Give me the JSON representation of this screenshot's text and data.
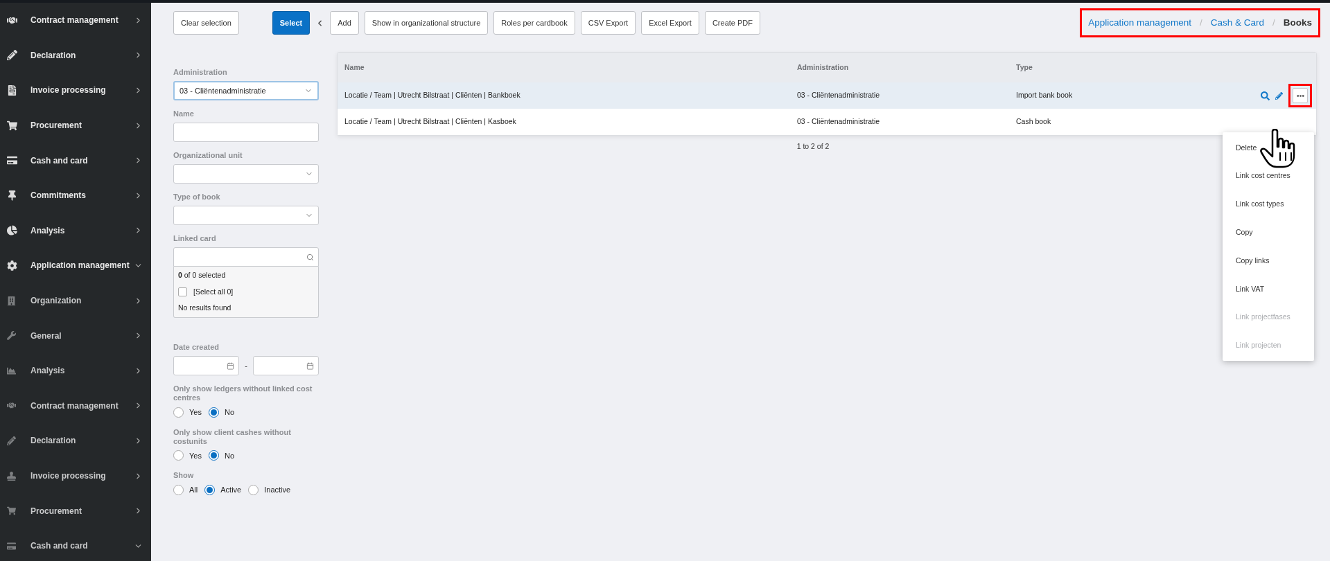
{
  "sidebar": {
    "items": [
      {
        "label": "Contract management",
        "expanded": false
      },
      {
        "label": "Declaration",
        "expanded": false
      },
      {
        "label": "Invoice processing",
        "expanded": false
      },
      {
        "label": "Procurement",
        "expanded": false
      },
      {
        "label": "Cash and card",
        "expanded": false
      },
      {
        "label": "Commitments",
        "expanded": false
      },
      {
        "label": "Analysis",
        "expanded": false
      },
      {
        "label": "Application management",
        "expanded": true,
        "children": [
          {
            "label": "Organization",
            "expanded": false
          },
          {
            "label": "General",
            "expanded": false
          },
          {
            "label": "Analysis",
            "expanded": false
          },
          {
            "label": "Contract management",
            "expanded": false
          },
          {
            "label": "Declaration",
            "expanded": false
          },
          {
            "label": "Invoice processing",
            "expanded": false
          },
          {
            "label": "Procurement",
            "expanded": false
          },
          {
            "label": "Cash and card",
            "expanded": true
          }
        ]
      }
    ]
  },
  "toolbar": {
    "buttons": [
      {
        "label": "Clear selection",
        "kind": "default"
      },
      {
        "label": "Select",
        "kind": "primary"
      },
      {
        "label": "Add",
        "kind": "default"
      },
      {
        "label": "Show in organizational structure",
        "kind": "default"
      },
      {
        "label": "Roles per cardbook",
        "kind": "default"
      },
      {
        "label": "CSV Export",
        "kind": "default"
      },
      {
        "label": "Excel Export",
        "kind": "default"
      },
      {
        "label": "Create PDF",
        "kind": "default"
      }
    ]
  },
  "breadcrumb_separator": "/",
  "breadcrumb": [
    {
      "label": "Application management",
      "kind": "link"
    },
    {
      "label": "Cash & Card",
      "kind": "link"
    },
    {
      "label": "Books",
      "kind": "current"
    }
  ],
  "filters": [
    {
      "kind": "select",
      "label": "Administration",
      "value": "03 - Cliëntenadministratie",
      "focused": true
    },
    {
      "kind": "text",
      "label": "Name"
    },
    {
      "kind": "select",
      "label": "Organizational unit",
      "focused": false
    },
    {
      "kind": "select",
      "label": "Type of book",
      "focused": false
    },
    {
      "kind": "multiselect",
      "label": "Linked card",
      "summary": "**0** of 0 selected",
      "select_all": "[Select all 0]",
      "select_all_checked": false,
      "empty_text": "No results found"
    },
    {
      "kind": "daterange",
      "label": "Date created",
      "separator": "-"
    },
    {
      "kind": "radio",
      "label": "Only show ledgers without linked cost centres",
      "options": [
        {
          "label": "Yes",
          "selected": false
        },
        {
          "label": "No",
          "selected": true
        }
      ]
    },
    {
      "kind": "radio",
      "label": "Only show client cashes without costunits",
      "options": [
        {
          "label": "Yes",
          "selected": false
        },
        {
          "label": "No",
          "selected": true
        }
      ]
    },
    {
      "kind": "radio",
      "label": "Show",
      "options": [
        {
          "label": "All",
          "selected": false
        },
        {
          "label": "Active",
          "selected": true
        },
        {
          "label": "Inactive",
          "selected": false
        }
      ]
    }
  ],
  "table": {
    "columns": [
      "Name",
      "Administration",
      "Type"
    ],
    "rows": [
      {
        "cells": [
          "Locatie / Team | Utrecht Bilstraat | Cliënten | Bankboek",
          "03 - Cliëntenadministratie",
          "Import bank book"
        ],
        "selected": true
      },
      {
        "cells": [
          "Locatie / Team | Utrecht Bilstraat | Cliënten | Kasboek",
          "03 - Cliëntenadministratie",
          "Cash book"
        ],
        "selected": false
      }
    ],
    "pagination": "1 to 2 of 2"
  },
  "row_menu": {
    "items": [
      {
        "label": "Delete",
        "disabled": false
      },
      {
        "label": "Link cost centres",
        "disabled": false
      },
      {
        "label": "Link cost types",
        "disabled": false
      },
      {
        "label": "Copy",
        "disabled": false
      },
      {
        "label": "Copy links",
        "disabled": false
      },
      {
        "label": "Link VAT",
        "disabled": false
      },
      {
        "label": "Link projectfases",
        "disabled": true
      },
      {
        "label": "Link projecten",
        "disabled": true
      }
    ]
  }
}
